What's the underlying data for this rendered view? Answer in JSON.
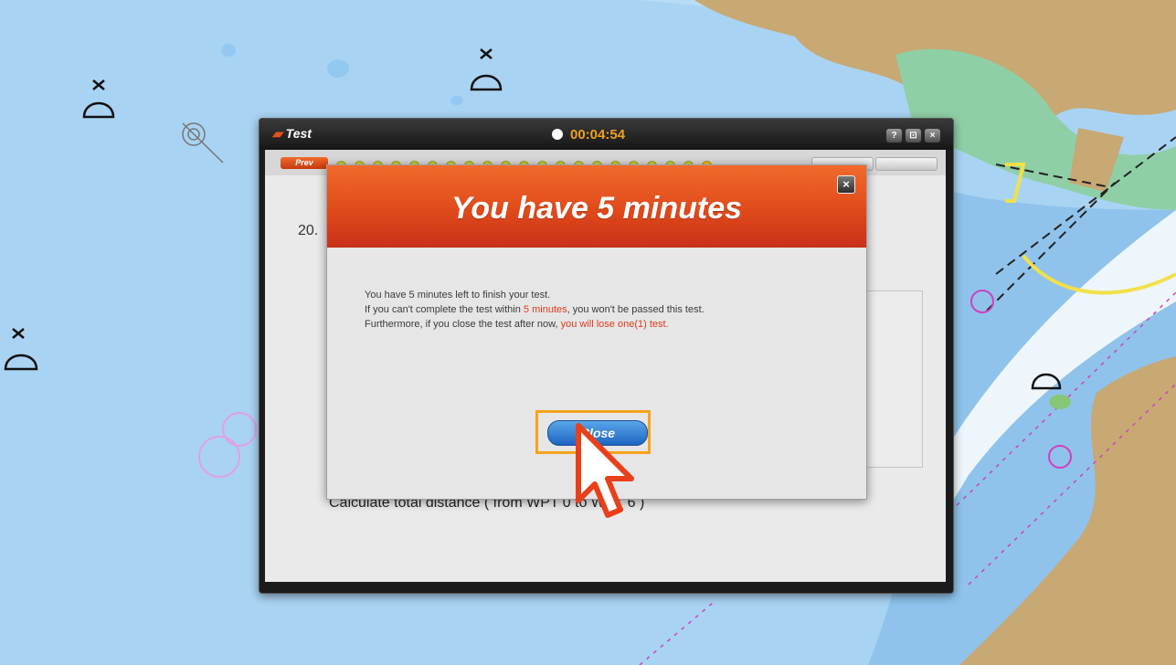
{
  "window": {
    "title": "Test",
    "timer": "00:04:54",
    "buttons": [
      "?",
      "⊡",
      "×"
    ],
    "prev_label": "Prev",
    "question_number": "20.",
    "question_text": "Calculate total distance ( from WPT 0 to WPT 6 )"
  },
  "progress": {
    "completed_count": 20,
    "total_count": 21
  },
  "modal": {
    "title": "You have 5 minutes",
    "close_glyph": "×",
    "line1": "You have 5 minutes left to finish your test.",
    "line2_pre": "If you can't complete the test within ",
    "line2_highlight": "5 minutes",
    "line2_post": ", you won't be passed this test.",
    "line3_pre": "Furthermore, if you close the test after now, ",
    "line3_highlight": "you will lose one(1) test.",
    "close_button": "Close"
  },
  "colors": {
    "accent": "#e8501d",
    "highlight_text": "#e03a1a",
    "focus_outline": "#f7a21b",
    "sea": "#a9d3f3",
    "land": "#c8a873"
  }
}
